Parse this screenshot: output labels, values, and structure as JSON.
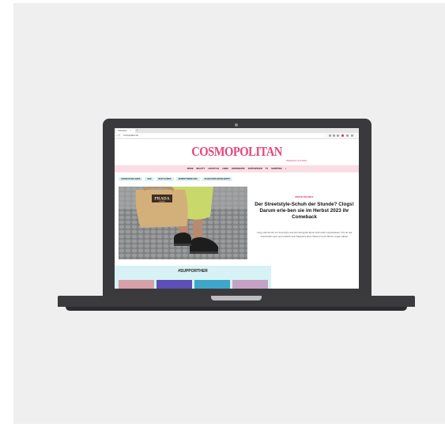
{
  "browser": {
    "tab_title": "Cosmopol...",
    "tab_close": "×",
    "new_tab": "+",
    "nav_arrows": "‹ › ↻",
    "url": "cosmopolitan.de",
    "extension_colors": [
      "#9e9e9e",
      "#9e9e9e",
      "#9e9e9e",
      "#e2246d",
      "#9e9e9e",
      "#9e9e9e"
    ]
  },
  "site": {
    "logo": "COSMOPOLITAN",
    "logo_color": "#e7457a",
    "login_links": "Registrieren   Anmelden",
    "menu_items": [
      "MODE",
      "BEAUTY",
      "LIFESTYLE",
      "LIEBE",
      "HOROSKOPE",
      "SUPPORTHER",
      "TV",
      "SHOPPING",
      "⌕"
    ],
    "chips": [
      "GRAND RUSHLANDS",
      "HED",
      "BEFT-GUIDES",
      "HERBSTTREND 2023",
      "SCHAUFENS BRANCHERTS"
    ],
    "accent_color": "#e2246d"
  },
  "article": {
    "kicker": "MODETRENDS",
    "headline": "Der Streetstyle-Schuh der Stunde? Clogs! Darum erle-ben sie im Herbst 2023 ihr Comeback",
    "teaser": "Clogs sind derzeit der Streetstyle-und laut Instagram Mode nicht mehr wegzudenken. Wie du den Trendschuh stylst und weshalb auch Megafans ihren Sinnes-Favorit Herbst wegen zählen.",
    "bag_brand": "PRADA",
    "bag_subtitle": "MILANO"
  },
  "supporther": {
    "title": "#SUPPORTHER",
    "thumb_colors": [
      "#d6a0a8",
      "#5b4fb8",
      "#3ea6c8",
      "#c5a1c6"
    ]
  }
}
